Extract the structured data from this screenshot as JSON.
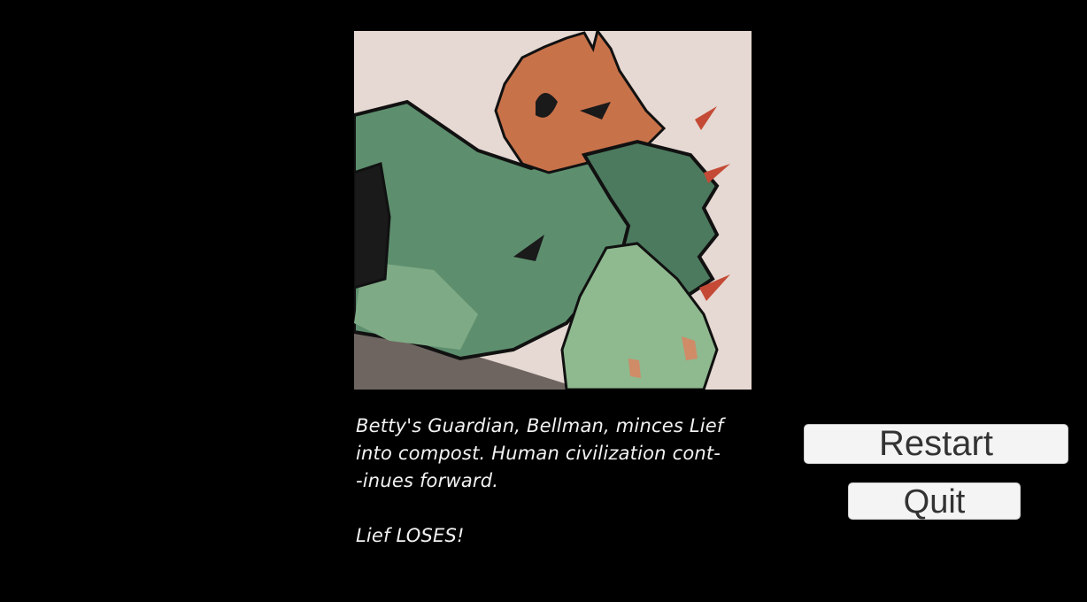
{
  "illustration": {
    "subject": "lief-defeated-illustration",
    "colors": {
      "background": "#e6d8d2",
      "guardian_green": "#5d8f6e",
      "guardian_light": "#8fb98f",
      "leaf_orange": "#c8724a",
      "outline": "#111111"
    }
  },
  "story": {
    "line1": "Betty's Guardian, Bellman, minces Lief",
    "line2": "into compost. Human civilization cont-",
    "line3": "-inues forward.",
    "result": "Lief LOSES!"
  },
  "buttons": {
    "restart_label": "Restart",
    "quit_label": "Quit"
  }
}
